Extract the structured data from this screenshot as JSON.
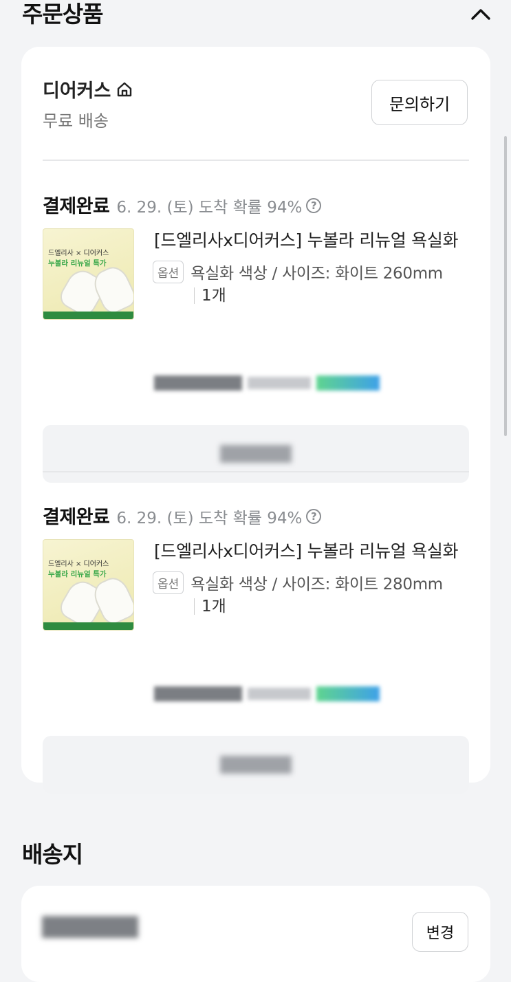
{
  "orders_section": {
    "title": "주문상품",
    "collapse_icon": "chevron-up-icon"
  },
  "seller": {
    "name": "디어커스",
    "store_icon": "store-home-icon",
    "shipping": "무료 배송",
    "inquiry_label": "문의하기"
  },
  "items": [
    {
      "status": "결제완료",
      "eta": "6. 29. (토) 도착 확률 94%",
      "help_icon": "question-circle-icon",
      "thumb_line1": "드엘리사 × 디어커스",
      "thumb_line2": "누볼라 리뉴얼 특가",
      "name": "[드엘리사x디어커스] 누볼라 리뉴얼 욕실화",
      "option_tag": "옵션",
      "option": "욕실화 색상 / 사이즈: 화이트 260mm",
      "qty": "1개"
    },
    {
      "status": "결제완료",
      "eta": "6. 29. (토) 도착 확률 94%",
      "help_icon": "question-circle-icon",
      "thumb_line1": "드엘리사 × 디어커스",
      "thumb_line2": "누볼라 리뉴얼 특가",
      "name": "[드엘리사x디어커스] 누볼라 리뉴얼 욕실화",
      "option_tag": "옵션",
      "option": "욕실화 색상 / 사이즈: 화이트 280mm",
      "qty": "1개"
    }
  ],
  "address_section": {
    "title": "배송지",
    "change_label": "변경"
  }
}
